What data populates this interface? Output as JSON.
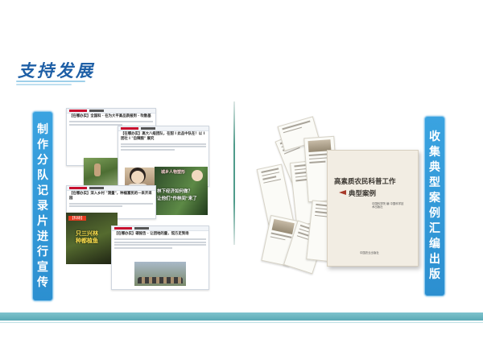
{
  "header": {
    "title": "支持发展"
  },
  "left_banner": {
    "chars": [
      "制",
      "作",
      "分",
      "队",
      "记",
      "录",
      "片",
      "进",
      "行",
      "宣",
      "传"
    ]
  },
  "right_banner": {
    "chars": [
      "收",
      "集",
      "典",
      "型",
      "案",
      "例",
      "汇",
      "编",
      "出",
      "版"
    ]
  },
  "collage": {
    "headline_1": "【在哪办实】全国科 · 在为大平高品质报到 · 吹散基",
    "headline_2": "【在哪办实】高大八级团队，在甜 l 此品中队在！以 l 团社 l \"自辣图\" 展究",
    "overlay_portrait": "城乡人物塑形",
    "overlay_forest_1": "林下经济如何做？",
    "overlay_forest_2": "让他们\"作林间\"来了",
    "headline_3": "【在哪办实】深入乡村 \"测量\"，种植富民的一来开采园",
    "overlay_video_tag": "【科研】",
    "overlay_video_1": "只三兴林",
    "overlay_video_2": "种都植鱼",
    "headline_4": "【在哪办实】碳报告 · 让团地的量，馆方足到场"
  },
  "book": {
    "title": "高素质农民科普工作",
    "subtitle": "典型案例",
    "author": "中国科学院 编 中国科学技术出版社",
    "publisher": "中国农业出版社"
  },
  "colors": {
    "title": "#1e5fa6",
    "banner": "#3aa3e0",
    "divider": "#4f9b8a",
    "band": "#6bb7c2"
  }
}
